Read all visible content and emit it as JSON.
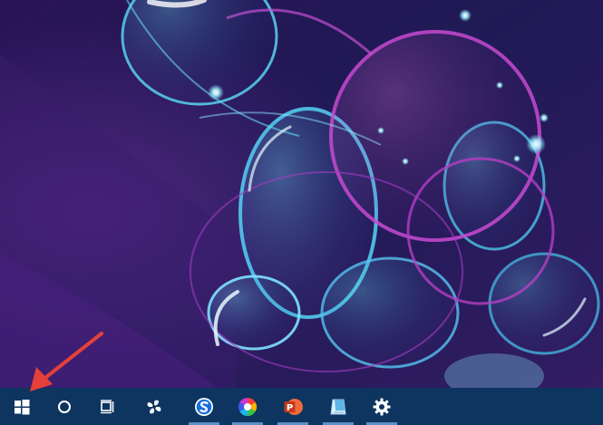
{
  "desktop": {
    "wallpaper": "purple-blue-bubbles",
    "colors": {
      "base": "#24124f",
      "bubble_cyan": "#4fd4f0",
      "bubble_magenta": "#c846c8"
    }
  },
  "annotation": {
    "type": "red-arrow",
    "target": "start-button",
    "color": "#e5403a"
  },
  "taskbar": {
    "background": "#0d3560",
    "items": [
      {
        "name": "start-button",
        "icon": "windows-logo-icon",
        "running": false
      },
      {
        "name": "search-button",
        "icon": "search-circle-icon",
        "running": false
      },
      {
        "name": "task-view-button",
        "icon": "task-view-icon",
        "running": false
      },
      {
        "name": "pinwheel-app-button",
        "icon": "pinwheel-app-icon",
        "running": false
      },
      {
        "name": "sogou-browser-button",
        "icon": "sogou-s-icon",
        "running": true
      },
      {
        "name": "color-wheel-app-button",
        "icon": "color-wheel-icon",
        "running": true
      },
      {
        "name": "powerpoint-button",
        "icon": "powerpoint-icon",
        "running": true,
        "label": "P"
      },
      {
        "name": "notepad-app-button",
        "icon": "notepad-icon",
        "running": true
      },
      {
        "name": "settings-button",
        "icon": "gear-icon",
        "running": true
      }
    ]
  }
}
